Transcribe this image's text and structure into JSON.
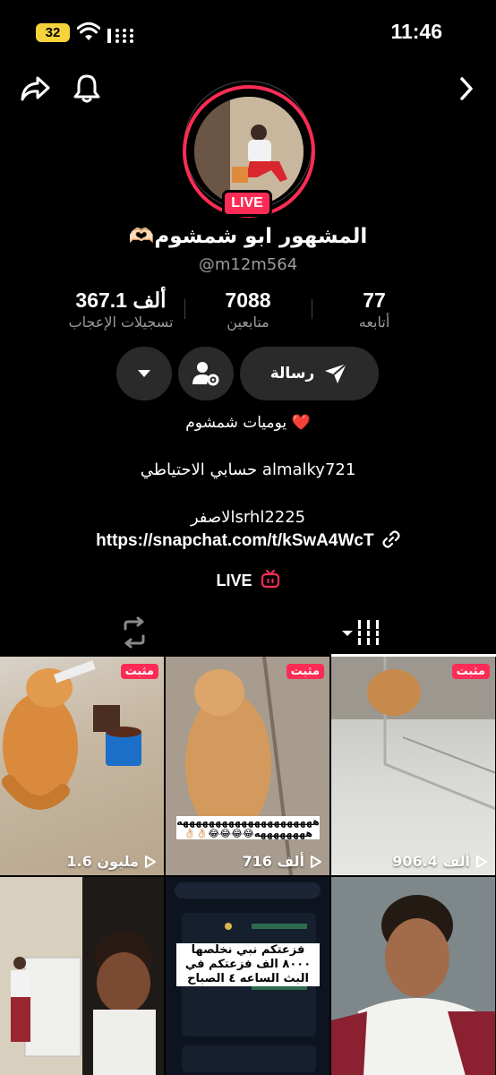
{
  "status_bar": {
    "battery": "32",
    "time": "11:46"
  },
  "profile": {
    "live_badge": "LIVE",
    "name": "المشهور ابو شمشوم🫶🏻",
    "handle": "@m12m564",
    "stats": [
      {
        "value": "367.1 ألف",
        "label": "تسجيلات الإعجاب"
      },
      {
        "value": "7088",
        "label": "متابعين"
      },
      {
        "value": "77",
        "label": "أتابعه"
      }
    ],
    "message_label": "رسالة",
    "bio": {
      "line1": "يوميات شمشوم ❤️",
      "line2": "حسابي الاحتياطي almalky721",
      "line3": "الاصفرsrhl2225",
      "link": "https://snapchat.com/t/kSwA4WcT"
    },
    "live_link": "LIVE"
  },
  "grid": {
    "pinned_label": "مثبت",
    "items": [
      {
        "views": "1.6 مليون",
        "pinned": true
      },
      {
        "views": "716 ألف",
        "pinned": true,
        "caption": "هههههههههههههههههههههه ههههههههه😂😂😂😂👌🏻👌🏻"
      },
      {
        "views": "906.4 ألف",
        "pinned": true
      },
      {
        "views": ""
      },
      {
        "views": "",
        "caption": "فزعتكم نبي نخلصها ٨٠٠٠ الف فزعتكم في البث الساعه ٤ الصباح"
      },
      {
        "views": ""
      }
    ]
  },
  "colors": {
    "accent": "#fe2c55",
    "button_bg": "#2a2a2a",
    "muted": "#9a9a9a"
  }
}
